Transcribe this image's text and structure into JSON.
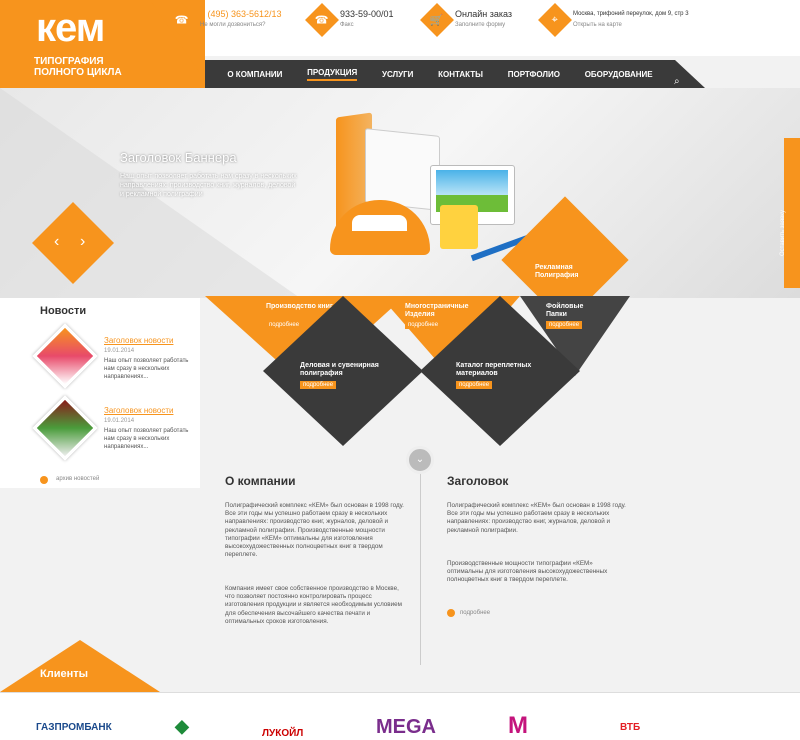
{
  "header": {
    "logo_mark": "кем",
    "logo_subtitle": "ТИПОГРАФИЯ ПОЛНОГО ЦИКЛА",
    "contacts": [
      {
        "icon": "phone-icon",
        "main": "8 (495) 363-5612/13",
        "sub": "Не могли дозвониться?"
      },
      {
        "icon": "phone-icon",
        "main": "933-59-00/01",
        "sub": "Факс"
      },
      {
        "icon": "cart-icon",
        "main": "Онлайн заказ",
        "sub": "Заполните форму"
      },
      {
        "icon": "location-icon",
        "main": "Москва, трифоний переулок, дом 9, стр 3",
        "sub": "Открыть на карте"
      }
    ]
  },
  "nav": {
    "items": [
      "О КОМПАНИИ",
      "ПРОДУКЦИЯ",
      "УСЛУГИ",
      "КОНТАКТЫ",
      "ПОРТФОЛИО",
      "ОБОРУДОВАНИЕ"
    ],
    "search_icon": "search-icon"
  },
  "banner": {
    "title": "Заголовок Баннера",
    "text": "Наш опыт позволяет работать нам сразу в нескольких направлениях: производство книг, журналов, деловой и рекламной полиграфии"
  },
  "tiles": [
    {
      "label": "Рекламная Полиграфия",
      "more": "подробнее"
    },
    {
      "label": "Производство книг",
      "more": "подробнее"
    },
    {
      "label": "Многостраничные Изделия",
      "more": "подробнее"
    },
    {
      "label": "Фойловые Папки",
      "more": "подробнее"
    },
    {
      "label": "Деловая и сувенирная полиграфия",
      "more": "подробнее"
    },
    {
      "label": "Каталог переплетных материалов",
      "more": "подробнее"
    }
  ],
  "news": {
    "title": "Новости",
    "items": [
      {
        "link": "Заголовок новости",
        "date": "19.01.2014",
        "text": "Наш опыт позволяет работать нам сразу в нескольких направлениях..."
      },
      {
        "link": "Заголовок новости",
        "date": "19.01.2014",
        "text": "Наш опыт позволяет работать нам сразу в нескольких направлениях..."
      }
    ],
    "archive": "архив новостей"
  },
  "about": {
    "title": "О компании",
    "p1": "Полиграфический комплекс «КЕМ» был основан в 1998 году. Все эти годы мы успешно работаем сразу в нескольких направлениях: производство книг, журналов, деловой и рекламной полиграфии. Производственные мощности типографии «КЕМ» оптимальны для изготовления высокохудожественных полноцветных книг в твердом переплете.",
    "p2": "Компания имеет свое собственное производство в Москве, что позволяет постоянно контролировать процесс изготовления продукции и является необходимым условием для обеспечения высочайшего качества печати и оптимальных сроков изготовления."
  },
  "second": {
    "title": "Заголовок",
    "p1": "Полиграфический комплекс «КЕМ» был основан в 1998 году. Все эти годы мы успешно работаем сразу в нескольких направлениях: производство книг, журналов, деловой и рекламной полиграфии.",
    "p2": "Производственные мощности типографии «КЕМ» оптимальны для изготовления высокохудожественных полноцветных книг в твердом переплете.",
    "more": "подробнее"
  },
  "clients": {
    "label": "Клиенты",
    "logos": [
      "ГАЗПРОМБАНК",
      "СБЕРБАНК",
      "ЛУКОЙЛ",
      "MEGA",
      "M",
      "ВТБ"
    ]
  },
  "side_tab": "Оставить заявку",
  "colors": {
    "accent": "#f7941d",
    "dark": "#3a3a3a"
  }
}
